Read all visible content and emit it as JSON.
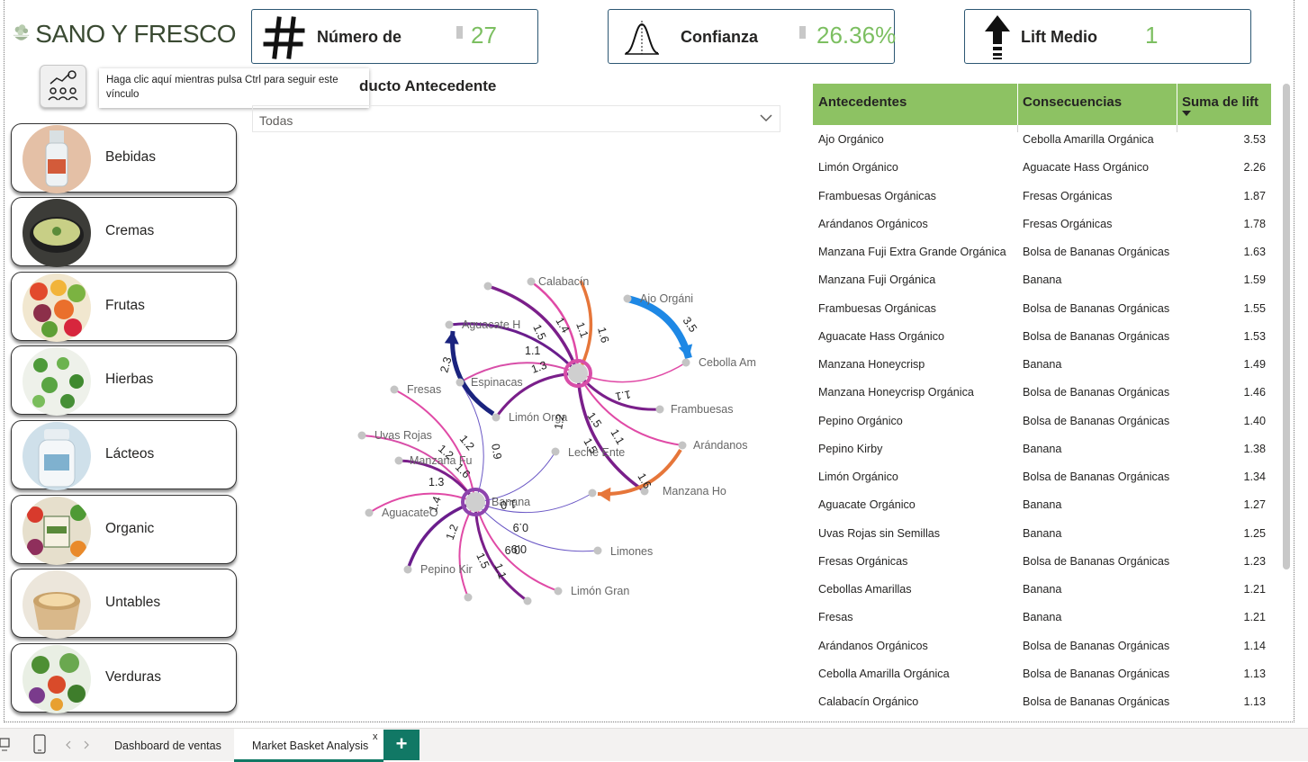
{
  "brand": {
    "name": "SANO Y FRESCO"
  },
  "kpis": [
    {
      "label": "Número de",
      "value": "27",
      "icon": "hash-icon"
    },
    {
      "label": "Confianza",
      "value": "26.36%",
      "icon": "bell-curve-icon"
    },
    {
      "label": "Lift Medio",
      "value": "1",
      "icon": "arrow-up-icon"
    }
  ],
  "tooltip": {
    "text": "Haga clic aquí mientras pulsa Ctrl para seguir este vínculo"
  },
  "slicer": {
    "title": "ducto Antecedente",
    "value": "Todas"
  },
  "categories": [
    {
      "label": "Bebidas",
      "icon": "bottle-icon"
    },
    {
      "label": "Cremas",
      "icon": "soup-bowl-icon"
    },
    {
      "label": "Frutas",
      "icon": "fruits-icon"
    },
    {
      "label": "Hierbas",
      "icon": "herbs-icon"
    },
    {
      "label": "Lácteos",
      "icon": "milk-icon"
    },
    {
      "label": "Organic",
      "icon": "organic-produce-icon"
    },
    {
      "label": "Untables",
      "icon": "spread-tub-icon"
    },
    {
      "label": "Verduras",
      "icon": "vegetables-icon"
    }
  ],
  "network": {
    "node_labels": [
      "Calabacín",
      "Ajo Orgáni",
      "Aguacate H",
      "Cebolla Am",
      "Espinacas",
      "Fresas",
      "Limón Orga",
      "Frambuesas",
      "Arándanos",
      "Uvas Rojas",
      "Leche Ente",
      "Manzana Fu",
      "Manzana Ho",
      "Banana",
      "AguacateO",
      "Limones",
      "Pepino Kir",
      "Limón Gran"
    ],
    "edge_labels": [
      "1.5",
      "1.4",
      "1.1",
      "1.6",
      "3.5",
      "1.1",
      "1.3",
      "2.3",
      "1.1",
      "1.1",
      "1.5",
      "1.5",
      "1.2",
      "1.6",
      "1.2",
      "0.9",
      "1.2",
      "1.6",
      "1.3",
      "1.4",
      "0.9",
      "0.9",
      "1.0",
      "1.2",
      "1.5",
      "1.1",
      "0.9"
    ]
  },
  "table": {
    "headers": [
      "Antecedentes",
      "Consecuencias",
      "Suma de lift"
    ],
    "rows": [
      [
        "Ajo Orgánico",
        "Cebolla Amarilla Orgánica",
        "3.53"
      ],
      [
        "Limón Orgánico",
        "Aguacate Hass Orgánico",
        "2.26"
      ],
      [
        "Frambuesas Orgánicas",
        "Fresas Orgánicas",
        "1.87"
      ],
      [
        "Arándanos Orgánicos",
        "Fresas Orgánicas",
        "1.78"
      ],
      [
        "Manzana Fuji Extra Grande Orgánica",
        "Bolsa de Bananas Orgánicas",
        "1.63"
      ],
      [
        "Manzana Fuji Orgánica",
        "Banana",
        "1.59"
      ],
      [
        "Frambuesas Orgánicas",
        "Bolsa de Bananas Orgánicas",
        "1.55"
      ],
      [
        "Aguacate Hass Orgánico",
        "Bolsa de Bananas Orgánicas",
        "1.53"
      ],
      [
        "Manzana Honeycrisp",
        "Banana",
        "1.49"
      ],
      [
        "Manzana Honeycrisp Orgánica",
        "Bolsa de Bananas Orgánicas",
        "1.46"
      ],
      [
        "Pepino Orgánico",
        "Bolsa de Bananas Orgánicas",
        "1.40"
      ],
      [
        "Pepino Kirby",
        "Banana",
        "1.38"
      ],
      [
        "Limón Orgánico",
        "Bolsa de Bananas Orgánicas",
        "1.34"
      ],
      [
        "Aguacate Orgánico",
        "Banana",
        "1.27"
      ],
      [
        "Uvas Rojas sin Semillas",
        "Banana",
        "1.25"
      ],
      [
        "Fresas Orgánicas",
        "Bolsa de Bananas Orgánicas",
        "1.23"
      ],
      [
        "Cebollas Amarillas",
        "Banana",
        "1.21"
      ],
      [
        "Fresas",
        "Banana",
        "1.21"
      ],
      [
        "Arándanos Orgánicos",
        "Bolsa de Bananas Orgánicas",
        "1.14"
      ],
      [
        "Cebolla Amarilla Orgánica",
        "Bolsa de Bananas Orgánicas",
        "1.13"
      ],
      [
        "Calabacín Orgánico",
        "Bolsa de Bananas Orgánicas",
        "1.13"
      ]
    ]
  },
  "tabs": [
    {
      "label": "Dashboard de ventas"
    },
    {
      "label": "Market Basket Analysis",
      "close": "x"
    }
  ],
  "add_tab": "+",
  "colors": {
    "accent_green": "#7cbf61",
    "header_green": "#8dc263",
    "tab_green": "#117865",
    "card_border": "#2c5773"
  }
}
